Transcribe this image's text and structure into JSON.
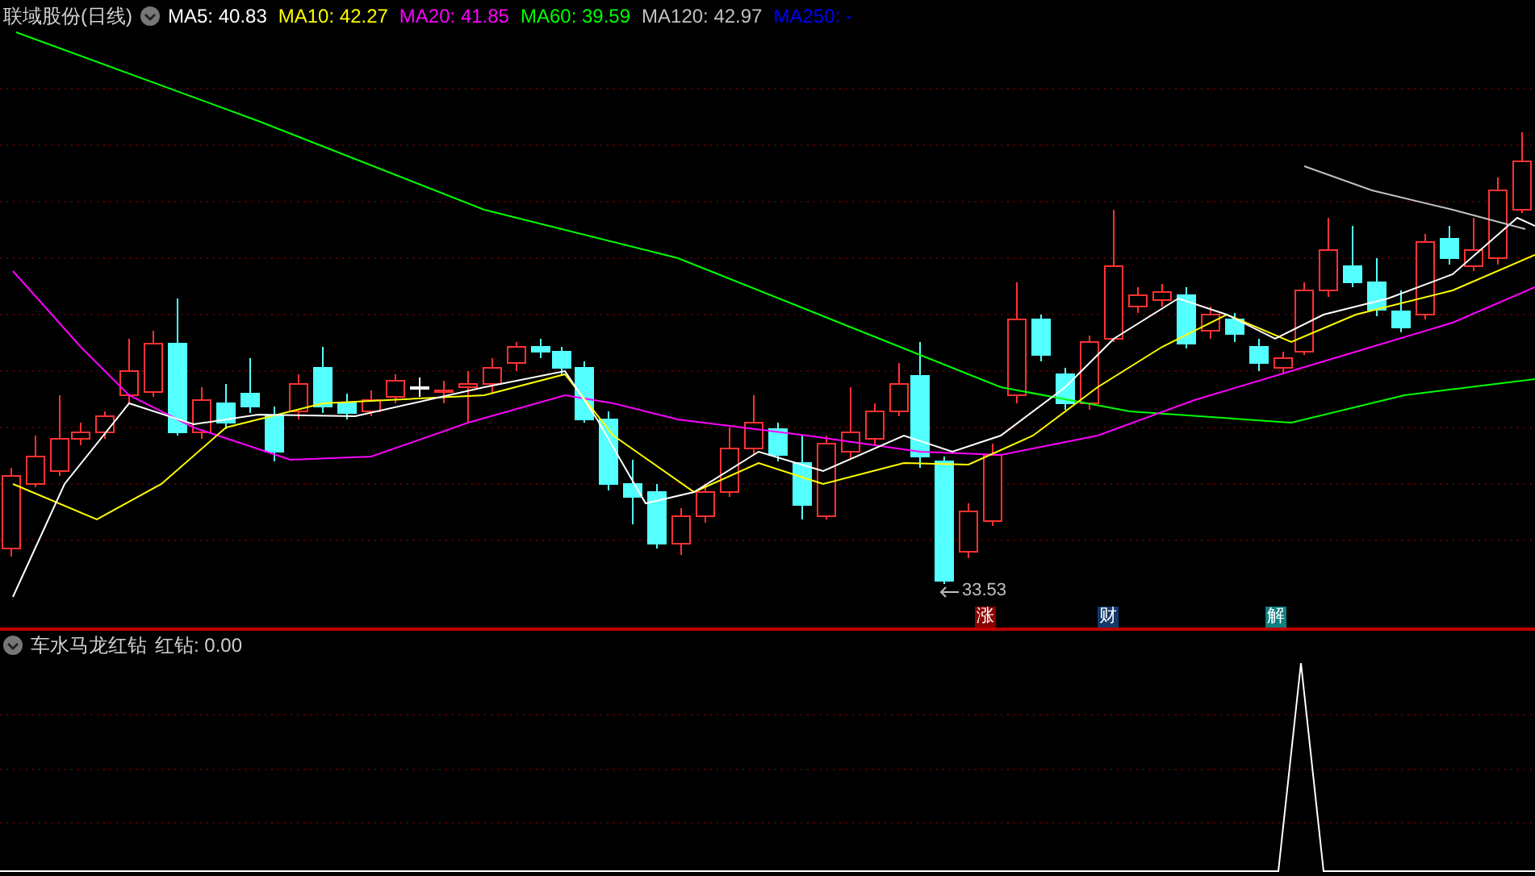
{
  "chart_header": {
    "title": "联域股份(日线)",
    "moving_averages": [
      {
        "text": "MA5: 40.83",
        "color": "#ffffff"
      },
      {
        "text": "MA10: 42.27",
        "color": "#ffff00"
      },
      {
        "text": "MA20: 41.85",
        "color": "#ff00ff"
      },
      {
        "text": "MA60: 39.59",
        "color": "#00ff00"
      },
      {
        "text": "MA120: 42.97",
        "color": "#c0c0c0"
      },
      {
        "text": "MA250: -",
        "color": "#0000ff"
      }
    ]
  },
  "low_marker": "33.53",
  "events": [
    {
      "text": "涨",
      "color": "#8b0000"
    },
    {
      "text": "财",
      "color": "#123a6b"
    },
    {
      "text": "解",
      "color": "#0f7f7f"
    }
  ],
  "indicator": {
    "name": "车水马龙红钻",
    "reading": "红钻: 0.00"
  }
}
